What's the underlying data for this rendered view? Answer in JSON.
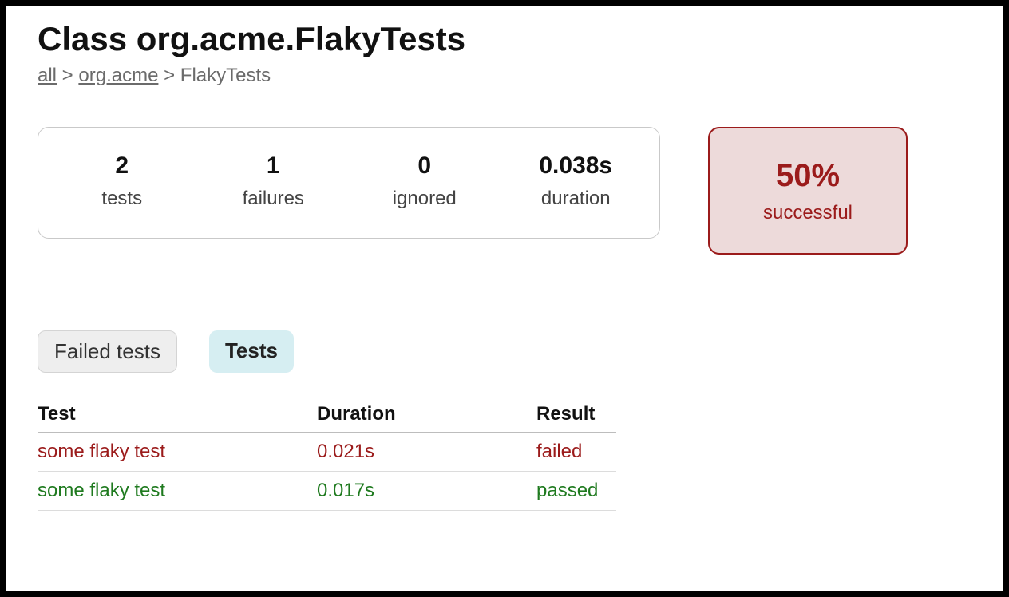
{
  "header": {
    "title": "Class org.acme.FlakyTests",
    "breadcrumb": {
      "all": "all",
      "sep": " > ",
      "package": "org.acme",
      "current": "FlakyTests"
    }
  },
  "summary": {
    "tests": {
      "value": "2",
      "label": "tests"
    },
    "failures": {
      "value": "1",
      "label": "failures"
    },
    "ignored": {
      "value": "0",
      "label": "ignored"
    },
    "duration": {
      "value": "0.038s",
      "label": "duration"
    }
  },
  "success": {
    "percent": "50%",
    "label": "successful",
    "color": "#9b1b1b"
  },
  "tabs": {
    "failed": "Failed tests",
    "tests": "Tests",
    "active": "tests"
  },
  "columns": {
    "test": "Test",
    "duration": "Duration",
    "result": "Result"
  },
  "rows": [
    {
      "name": "some flaky test",
      "duration": "0.021s",
      "result": "failed",
      "status": "failed"
    },
    {
      "name": "some flaky test",
      "duration": "0.017s",
      "result": "passed",
      "status": "passed"
    }
  ]
}
